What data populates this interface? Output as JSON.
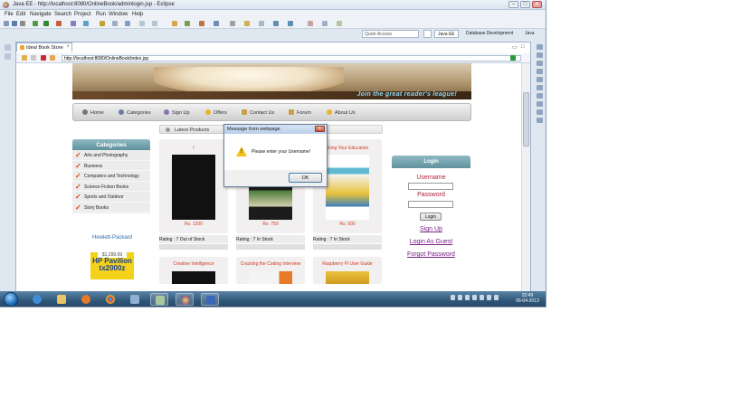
{
  "window": {
    "title": "Java EE - http://localhost:8080/OnlineBook/adminlogin.jsp - Eclipse",
    "min": "–",
    "max": "□",
    "close": "✕"
  },
  "menu": [
    "File",
    "Edit",
    "Navigate",
    "Search",
    "Project",
    "Run",
    "Window",
    "Help"
  ],
  "quick_access": "Quick Access",
  "perspectives": [
    "Java EE",
    "Database Development",
    "Java"
  ],
  "editor": {
    "tab_label": "Ideal Book Store",
    "url": "http://localhost:8080/OnlineBook/index.jsp"
  },
  "site": {
    "slogan": "Join the great reader's league!",
    "nav": [
      "Home",
      "Categories",
      "Sign Up",
      "Offers",
      "Contact Us",
      "Forum",
      "About Us"
    ],
    "latest_label": "Latest Products",
    "categories_title": "Categories",
    "categories": [
      "Arts and Photography",
      "Business",
      "Computers and Technology",
      "Science Fiction Books",
      "Sports and Outdoor",
      "Story Books"
    ],
    "ad": {
      "brand": "Hewlett-Packard",
      "price": "$1,299.99",
      "model": "HP Pavilion tx2000z"
    },
    "products": [
      {
        "title": "I",
        "price": "Rs. 1200",
        "rating": "Rating : 7 Out of Stock"
      },
      {
        "title": "",
        "price": "Rs. 750",
        "rating": "Rating : 7 In Stock"
      },
      {
        "title": "cking Your Education",
        "price": "Rs. 500",
        "rating": "Rating : 7 In Stock"
      }
    ],
    "products_row2": [
      "Creative Intelligence",
      "Cracking the Coding Interview",
      "Raspberry Pi User Guide"
    ],
    "login": {
      "title": "Login",
      "username_label": "Username",
      "password_label": "Password",
      "button": "Login",
      "signup": "Sign Up",
      "guest": "Login As Guest",
      "forgot": "Forgot Password"
    }
  },
  "dialog": {
    "title": "Message from webpage",
    "message": "Please enter your Username!",
    "ok": "OK"
  },
  "taskbar": {
    "time": "22:49",
    "date": "06-04-2013"
  },
  "colors": {
    "accent": "#5f929d",
    "red": "#d03c20",
    "label": "#b01e3a",
    "link": "#7a1f86"
  }
}
